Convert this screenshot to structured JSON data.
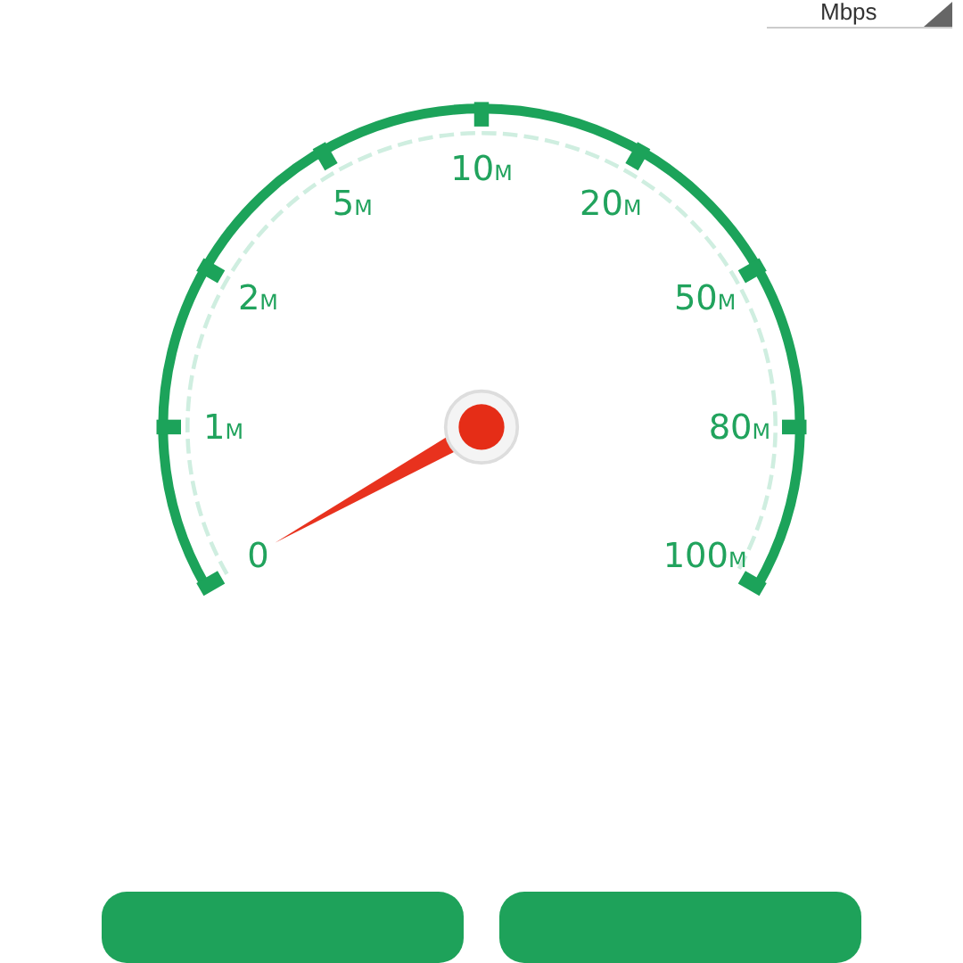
{
  "unit_selector": {
    "label": "Mbps"
  },
  "gauge": {
    "labels": [
      {
        "value": "0"
      },
      {
        "value": "1",
        "unit": "M"
      },
      {
        "value": "2",
        "unit": "M"
      },
      {
        "value": "5",
        "unit": "M"
      },
      {
        "value": "10",
        "unit": "M"
      },
      {
        "value": "20",
        "unit": "M"
      },
      {
        "value": "50",
        "unit": "M"
      },
      {
        "value": "80",
        "unit": "M"
      },
      {
        "value": "100",
        "unit": "M"
      }
    ]
  },
  "buttons": [
    {
      "kind": "primary"
    },
    {
      "kind": "primary"
    }
  ]
}
